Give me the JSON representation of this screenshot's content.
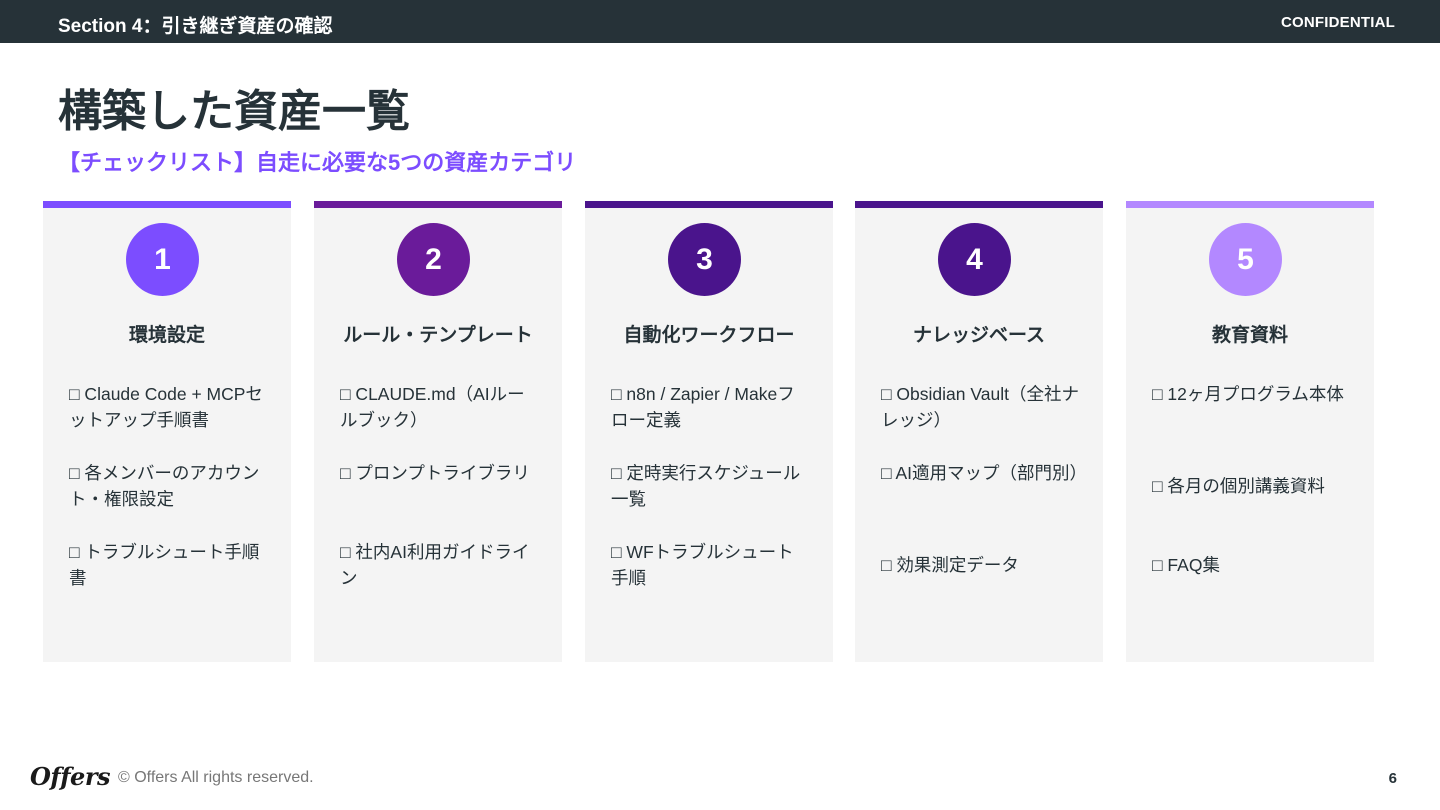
{
  "header": {
    "section_title": "Section 4：引き継ぎ資産の確認",
    "confidential": "CONFIDENTIAL"
  },
  "title": "構築した資産一覧",
  "subtitle": "【チェックリスト】自走に必要な5つの資産カテゴリ",
  "cards": [
    {
      "number": "1",
      "title": "環境設定",
      "color": "#7c4dff",
      "items": [
        "□ Claude Code + MCPセットアップ手順書",
        "□ 各メンバーのアカウント・権限設定",
        "□ トラブルシュート手順書"
      ]
    },
    {
      "number": "2",
      "title": "ルール・テンプレート",
      "color": "#6a1b9a",
      "items": [
        "□ CLAUDE.md（AIルールブック）",
        "□ プロンプトライブラリ",
        "□ 社内AI利用ガイドライン"
      ]
    },
    {
      "number": "3",
      "title": "自動化ワークフロー",
      "color": "#4a148c",
      "items": [
        "□ n8n / Zapier / Makeフロー定義",
        "□ 定時実行スケジュール一覧",
        "□ WFトラブルシュート手順"
      ]
    },
    {
      "number": "4",
      "title": "ナレッジベース",
      "color": "#4a148c",
      "items": [
        "□ Obsidian Vault（全社ナレッジ）",
        "□ AI適用マップ（部門別）",
        "□ 効果測定データ"
      ]
    },
    {
      "number": "5",
      "title": "教育資料",
      "color": "#b388ff",
      "items": [
        "□ 12ヶ月プログラム本体",
        "□ 各月の個別講義資料",
        "□ FAQ集"
      ]
    }
  ],
  "footer": {
    "logo": "Offers",
    "copyright": "© Offers All rights reserved.",
    "page_number": "6"
  }
}
